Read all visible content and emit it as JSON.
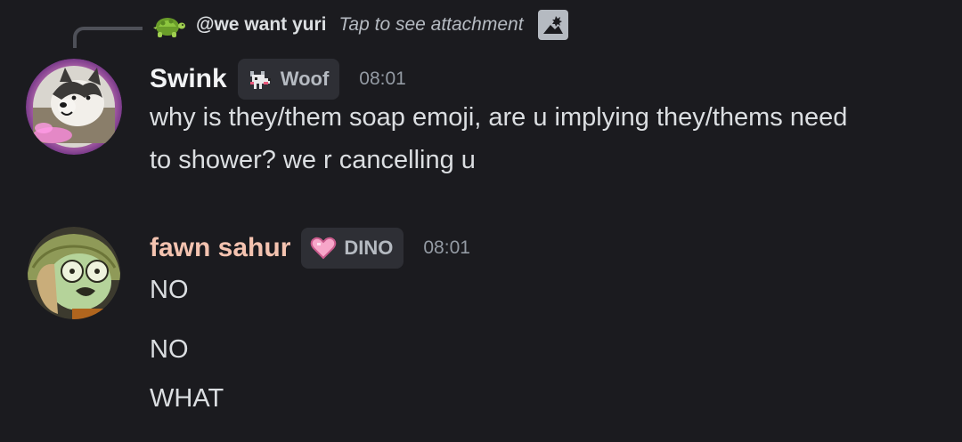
{
  "reply": {
    "author": "@we want yuri",
    "text": "Tap to see attachment",
    "avatar_icon": "turtle-icon",
    "attachment_icon": "image-icon"
  },
  "messages": [
    {
      "author": "Swink",
      "tag": "Woof",
      "tag_icon": "dog-pixel-icon",
      "time": "08:01",
      "lines": [
        "why is they/them soap emoji, are u implying they/thems need",
        "to shower? we r cancelling u"
      ],
      "author_color": "#f2f3f5"
    },
    {
      "author": "fawn sahur",
      "tag": "DINO",
      "tag_icon": "pink-heart-icon",
      "time": "08:01",
      "lines": [
        "NO",
        "NO",
        "WHAT"
      ],
      "author_color": "#f4c3b0"
    }
  ],
  "colors": {
    "background": "#1b1b1f",
    "text": "#dbdee1",
    "muted": "#949ba4",
    "tag_bg": "#2e2f35"
  }
}
